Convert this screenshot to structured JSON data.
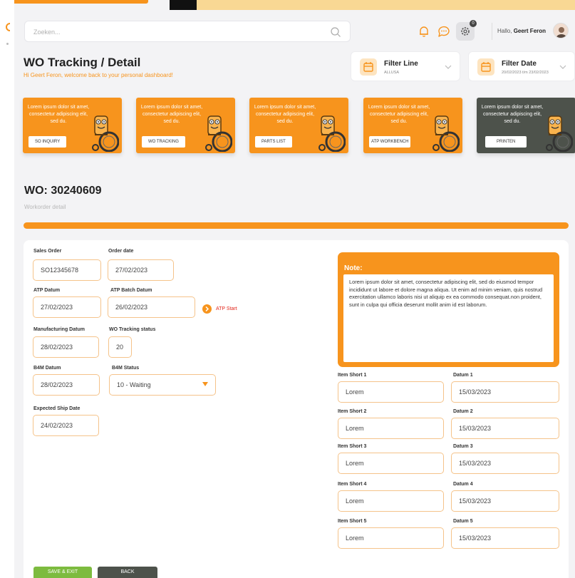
{
  "search": {
    "placeholder": "Zoeken..."
  },
  "header": {
    "notification_badge": "0",
    "greeting": "Hallo,",
    "user_name": "Geert Feron"
  },
  "page": {
    "title": "WO Tracking / Detail",
    "subtitle": "Hi Geert Feron, welcome back to your personal dashboard!"
  },
  "filters": [
    {
      "label": "Filter Line",
      "value": "ALLUSA"
    },
    {
      "label": "Filter Date",
      "value": "20/02/2023 t/m 23/02/2023"
    }
  ],
  "cards": [
    {
      "text": "Lorem ipsum dolor sit amet, consectetur adipiscing elit, sed du.",
      "button": "SO INQUIRY",
      "theme": "orange"
    },
    {
      "text": "Lorem ipsum dolor sit amet, consectetur adipiscing elit, sed du.",
      "button": "WO TRACKING",
      "theme": "orange"
    },
    {
      "text": "Lorem ipsum dolor sit amet, consectetur adipiscing elit, sed du.",
      "button": "PARTS LIST",
      "theme": "orange"
    },
    {
      "text": "Lorem ipsum dolor sit amet, consectetur adipiscing elit, sed du.",
      "button": "ATP WORKBENCH",
      "theme": "orange"
    },
    {
      "text": "Lorem ipsum dolor sit amet, consectetur adipiscing elit, sed du.",
      "button": "PRINTEN",
      "theme": "dark"
    }
  ],
  "wo": {
    "title": "WO: 30240609",
    "subtitle": "Workorder detail"
  },
  "form": {
    "sales_order": {
      "label": "Sales Order",
      "value": "SO12345678"
    },
    "order_date": {
      "label": "Order date",
      "value": "27/02/2023"
    },
    "atp_datum": {
      "label": "ATP Datum",
      "value": "27/02/2023"
    },
    "atp_batch_datum": {
      "label": "ATP Batch Datum",
      "value": "26/02/2023"
    },
    "atp_start": "ATP Start",
    "manufacturing_datum": {
      "label": "Manufacturing Datum",
      "value": "28/02/2023"
    },
    "wo_tracking_status": {
      "label": "WO Tracking status",
      "value": "20"
    },
    "b4m_datum": {
      "label": "B4M Datum",
      "value": "28/02/2023"
    },
    "b4m_status": {
      "label": "B4M Status",
      "value": "10 - Waiting"
    },
    "expected_ship_date": {
      "label": "Expected Ship Date",
      "value": "24/02/2023"
    }
  },
  "note": {
    "title": "Note:",
    "body": "Lorem ipsum dolor sit amet, consectetur adipiscing elit, sed do eiusmod tempor incididunt ut labore et dolore magna aliqua. Ut enim ad minim veniam, quis nostrud exercitation ullamco laboris nisi ut aliquip ex ea commodo consequat.non proident, sunt in culpa qui officia deserunt mollit anim id est laborum."
  },
  "items": [
    {
      "short_label": "Item Short 1",
      "short_value": "Lorem",
      "date_label": "Datum 1",
      "date_value": "15/03/2023"
    },
    {
      "short_label": "Item Short 2",
      "short_value": "Lorem",
      "date_label": "Datum 2",
      "date_value": "15/03/2023"
    },
    {
      "short_label": "Item Short 3",
      "short_value": "Lorem",
      "date_label": "Datum 3",
      "date_value": "15/03/2023"
    },
    {
      "short_label": "Item Short 4",
      "short_value": "Lorem",
      "date_label": "Datum 4",
      "date_value": "15/03/2023"
    },
    {
      "short_label": "Item Short 5",
      "short_value": "Lorem",
      "date_label": "Datum 5",
      "date_value": "15/03/2023"
    }
  ],
  "actions": {
    "save_exit": "SAVE & EXIT",
    "back": "BACK"
  },
  "colors": {
    "accent": "#f7941d",
    "dark": "#4d524b",
    "success": "#7dbb3f",
    "alert": "#e2261b"
  }
}
